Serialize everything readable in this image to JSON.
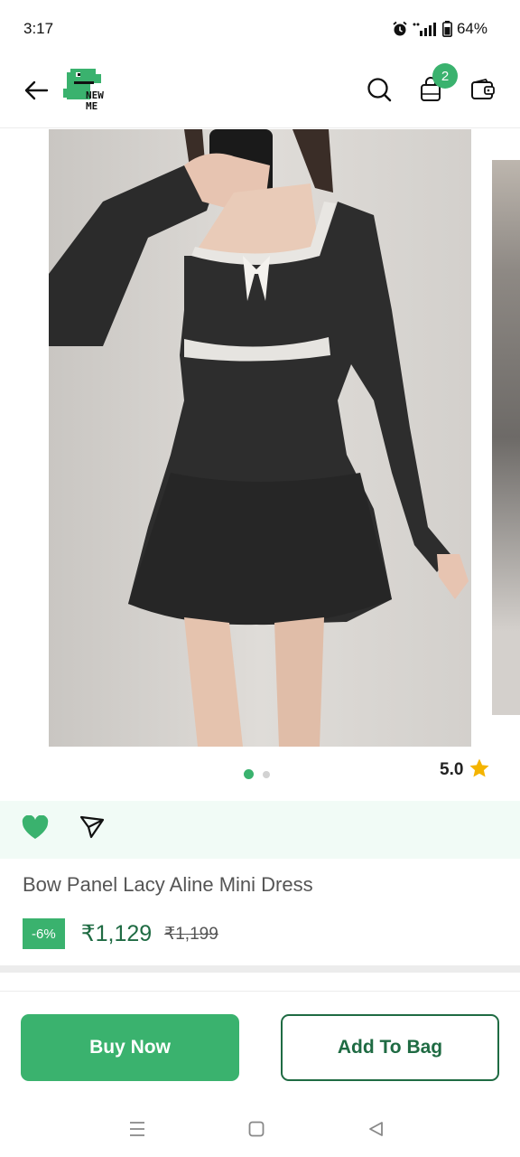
{
  "status_bar": {
    "time": "3:17",
    "battery": "64%"
  },
  "header": {
    "logo_text_line1": "NEW",
    "logo_text_line2": "ME",
    "bag_count": "2"
  },
  "gallery": {
    "image_count": 2,
    "active_index": 0
  },
  "rating": {
    "value": "5.0",
    "star_color": "#f4b400"
  },
  "product": {
    "title": "Bow Panel Lacy Aline Mini Dress",
    "discount": "-6%",
    "price": "₹1,129",
    "mrp": "₹1,199"
  },
  "actions": {
    "buy_now": "Buy Now",
    "add_to_bag": "Add To Bag"
  },
  "colors": {
    "brand_green": "#3ab26e",
    "dark_green": "#1f6b43",
    "strip_bg": "#f1fbf6"
  },
  "icons": [
    "back-arrow-icon",
    "search-icon",
    "bag-icon",
    "wallet-icon",
    "heart-icon",
    "share-icon",
    "star-icon",
    "menu-icon",
    "home-icon",
    "back-icon"
  ]
}
